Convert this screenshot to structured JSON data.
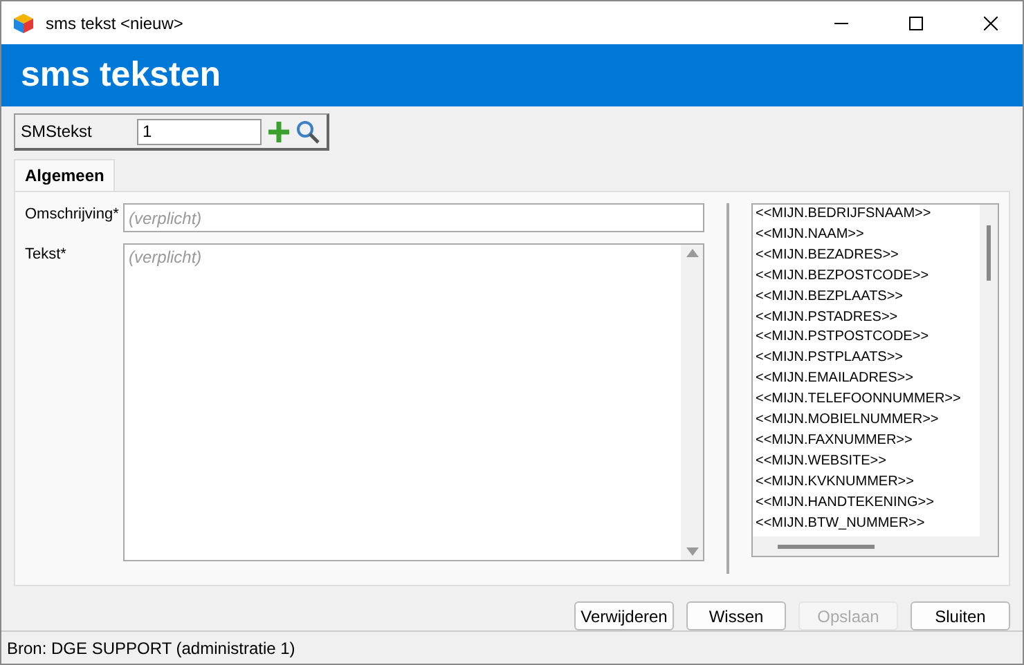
{
  "window": {
    "title": "sms tekst <nieuw>"
  },
  "header": {
    "title": "sms teksten"
  },
  "lookup": {
    "label": "SMStekst",
    "value": "1"
  },
  "tabs": [
    {
      "label": "Algemeen",
      "selected": true
    }
  ],
  "form": {
    "fields": [
      {
        "kind": "line",
        "label": "Omschrijving*",
        "placeholder": "(verplicht)"
      },
      {
        "kind": "area",
        "label": "Tekst*",
        "placeholder": "(verplicht)"
      }
    ]
  },
  "variables": [
    "<<MIJN.BEDRIJFSNAAM>>",
    "<<MIJN.NAAM>>",
    "<<MIJN.BEZADRES>>",
    "<<MIJN.BEZPOSTCODE>>",
    "<<MIJN.BEZPLAATS>>",
    "<<MIJN.PSTADRES>>",
    "<<MIJN.PSTPOSTCODE>>",
    "<<MIJN.PSTPLAATS>>",
    "<<MIJN.EMAILADRES>>",
    "<<MIJN.TELEFOONNUMMER>>",
    "<<MIJN.MOBIELNUMMER>>",
    "<<MIJN.FAXNUMMER>>",
    "<<MIJN.WEBSITE>>",
    "<<MIJN.KVKNUMMER>>",
    "<<MIJN.HANDTEKENING>>",
    "<<MIJN.BTW_NUMMER>>"
  ],
  "buttons": [
    {
      "label": "Verwijderen",
      "disabled": false
    },
    {
      "label": "Wissen",
      "disabled": false
    },
    {
      "label": "Opslaan",
      "disabled": true
    },
    {
      "label": "Sluiten",
      "disabled": false
    }
  ],
  "status_bar": "Bron: DGE SUPPORT (administratie 1)"
}
